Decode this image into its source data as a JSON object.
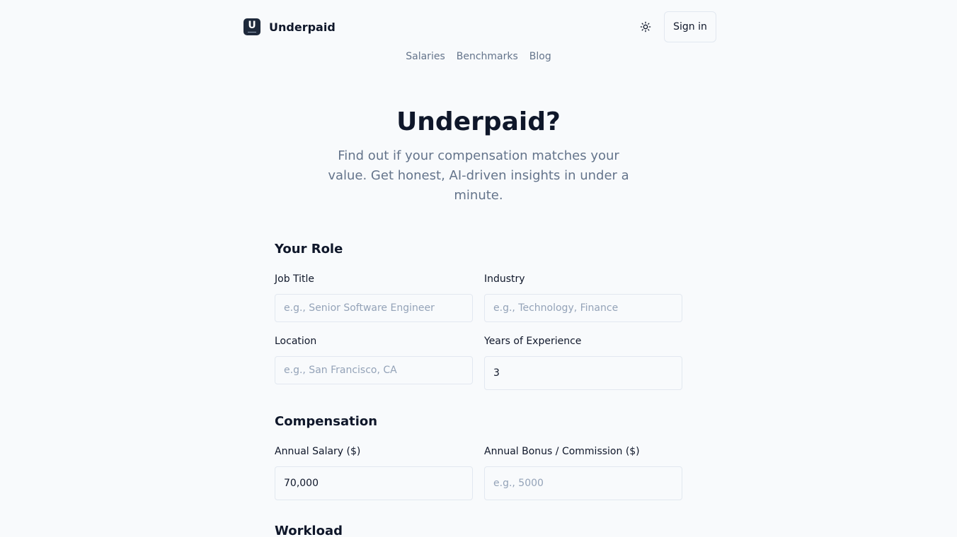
{
  "header": {
    "logo_letter": "U",
    "brand": "Underpaid",
    "theme_icon": "sun-icon",
    "signin_label": "Sign in"
  },
  "nav": {
    "items": [
      "Salaries",
      "Benchmarks",
      "Blog"
    ]
  },
  "hero": {
    "title": "Underpaid?",
    "subtitle": "Find out if your compensation matches your value. Get honest, AI-driven insights in under a minute."
  },
  "role": {
    "title": "Your Role",
    "job_title": {
      "label": "Job Title",
      "placeholder": "e.g., Senior Software Engineer",
      "value": ""
    },
    "industry": {
      "label": "Industry",
      "placeholder": "e.g., Technology, Finance",
      "value": ""
    },
    "location": {
      "label": "Location",
      "placeholder": "e.g., San Francisco, CA",
      "value": ""
    },
    "experience": {
      "label": "Years of Experience",
      "value": "3"
    }
  },
  "compensation": {
    "title": "Compensation",
    "salary": {
      "label": "Annual Salary ($)",
      "value": "70,000"
    },
    "bonus": {
      "label": "Annual Bonus / Commission ($)",
      "placeholder": "e.g., 5000",
      "value": ""
    }
  },
  "workload": {
    "title": "Workload"
  },
  "colors": {
    "background": "#f8fafc",
    "text": "#0f172a",
    "muted": "#64748b",
    "border": "#e2e8f0",
    "logo_bg": "#1e293b"
  }
}
